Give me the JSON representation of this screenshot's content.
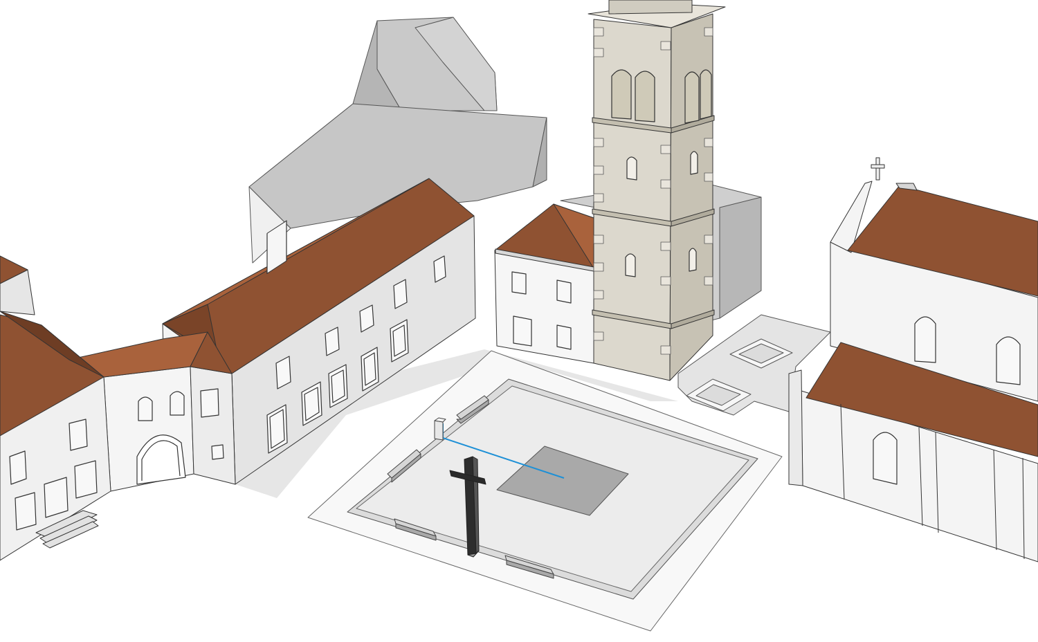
{
  "scene": {
    "kind": "3d-model-viewport",
    "background": "#ffffff",
    "colors": {
      "roof": "#8f5232",
      "roof_light": "#a9623c",
      "roof_dark": "#6e3d24",
      "wall_light": "#f2f2f2",
      "wall_mid": "#e2e2e2",
      "wall_shadow": "#c8c8c8",
      "massing_top": "#c6c6c6",
      "massing_side": "#a9a9a9",
      "tower_stone": "#dcd8cd",
      "tower_side": "#c7c2b4",
      "plaza_outer": "#f7f7f7",
      "plaza_inner": "#ebebeb",
      "plaza_center": "#a8a8a8",
      "cross": "#2f2f2f",
      "guide_line": "#1e90d6"
    },
    "objects": [
      "bell-tower",
      "corner-house",
      "long-building",
      "arched-gate-building",
      "left-building",
      "gray-massing",
      "church",
      "church-annex",
      "plaza",
      "cross-monument",
      "benches",
      "planters"
    ]
  }
}
